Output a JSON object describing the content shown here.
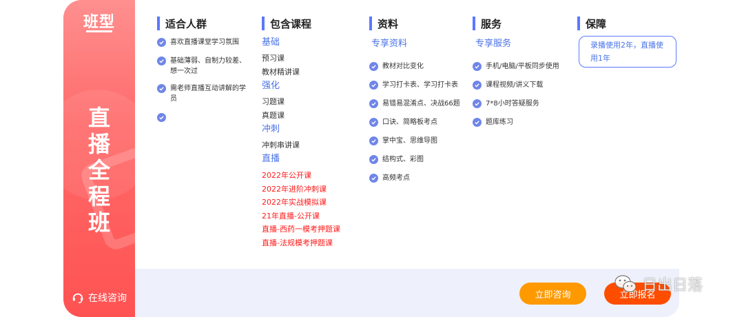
{
  "card": {
    "title": "班型",
    "name_chars": [
      "直",
      "播",
      "全",
      "程",
      "班"
    ],
    "consult_link": "在线咨询"
  },
  "columns": {
    "audience": {
      "title": "适合人群",
      "items": [
        "喜欢直播课堂学习氛围",
        "基础薄弱、自制力较差、想一次过",
        "需老师直播互动讲解的学员",
        ""
      ]
    },
    "courses": {
      "title": "包含课程",
      "groups": [
        {
          "name": "基础",
          "items": [
            "预习课",
            "教材精讲课"
          ]
        },
        {
          "name": "强化",
          "items": [
            "习题课",
            "真题课"
          ]
        },
        {
          "name": "冲刺",
          "items": [
            "冲刺串讲课"
          ]
        },
        {
          "name": "直播",
          "items": [
            "2022年公开课",
            "2022年进阶冲刺课",
            "2022年实战模拟课",
            "21年直播-公开课",
            "直播-西药一模考押题课",
            "直播-法规模考押题课"
          ]
        }
      ]
    },
    "materials": {
      "title": "资料",
      "subtitle": "专享资料",
      "items": [
        "教材对比变化",
        "学习打卡表、学习打卡表",
        "易错易混淆点、决战66题",
        "口诀、简略板考点",
        "掌中宝、思维导图",
        "结构式、彩图",
        "高频考点"
      ]
    },
    "services": {
      "title": "服务",
      "subtitle": "专享服务",
      "items": [
        "手机/电脑/平板同步使用",
        "课程视频/讲义下载",
        "7*8小时答疑服务",
        "题库练习"
      ]
    },
    "guarantee": {
      "title": "保障",
      "text": "录播使用2年，直播使用1年"
    }
  },
  "footer": {
    "consult_button": "立即咨询",
    "enroll_button": "立即报名"
  },
  "watermark": "日出日落",
  "colors": {
    "accent": "#5b78ff",
    "check": "#6f86e8",
    "red_text": "#ff1a1a",
    "orange_button": "#ff9900",
    "red_button": "#ff4d00"
  }
}
